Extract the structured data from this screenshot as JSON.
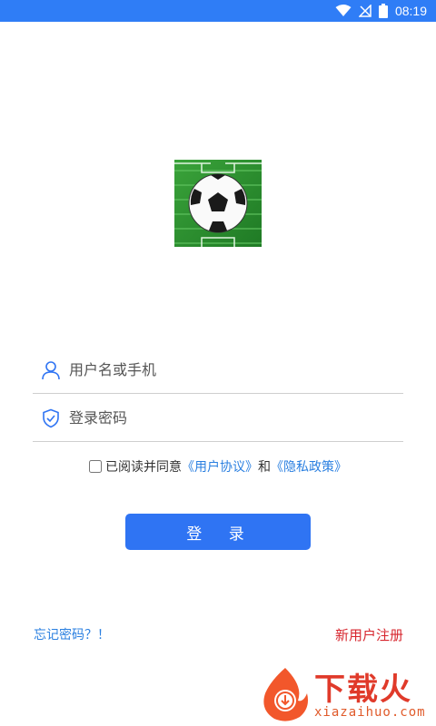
{
  "status_bar": {
    "time": "08:19",
    "icons": [
      "wifi-icon",
      "no-signal-icon",
      "battery-icon"
    ],
    "background": "#2f7df6"
  },
  "logo": {
    "icon": "soccer-ball-logo"
  },
  "form": {
    "username_placeholder": "用户名或手机",
    "password_placeholder": "登录密码"
  },
  "agreement": {
    "prefix": "已阅读并同意",
    "user_agreement": "《用户协议》",
    "conjunction": "和",
    "privacy_policy": "《隐私政策》",
    "checked": false
  },
  "login_button": {
    "label": "登 录",
    "color": "#2f74f3"
  },
  "footer": {
    "forgot_password": "忘记密码？！",
    "register": "新用户注册",
    "forgot_color": "#2a7fe0",
    "register_color": "#d7262e"
  },
  "watermark": {
    "title": "下载火",
    "subtitle": "xiazaihuo.com"
  }
}
